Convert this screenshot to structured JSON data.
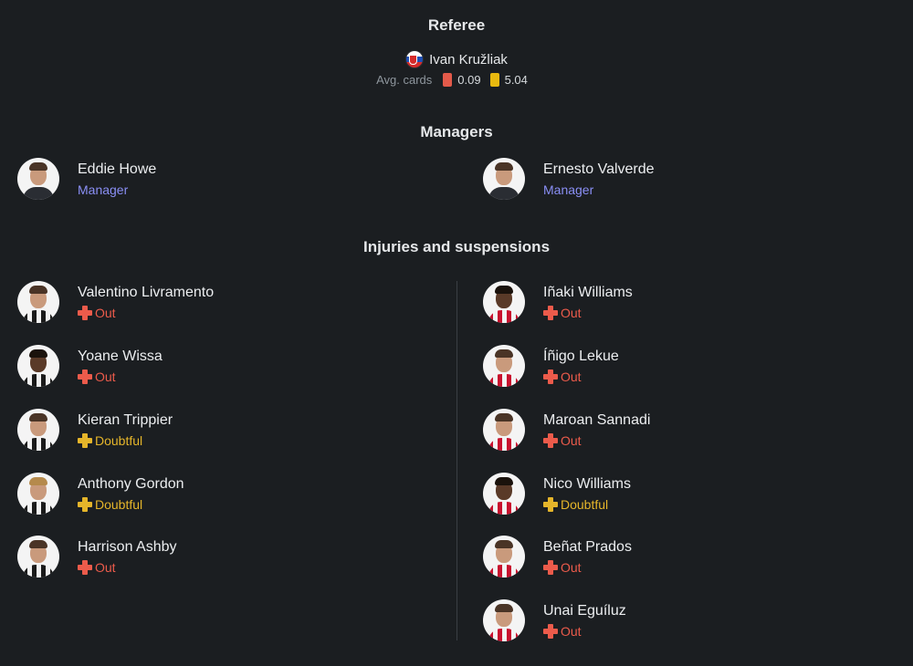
{
  "referee": {
    "title": "Referee",
    "name": "Ivan Kružliak",
    "avg_cards_label": "Avg. cards",
    "red_avg": "0.09",
    "yellow_avg": "5.04"
  },
  "managers": {
    "title": "Managers",
    "home": {
      "name": "Eddie Howe",
      "role": "Manager"
    },
    "away": {
      "name": "Ernesto Valverde",
      "role": "Manager"
    }
  },
  "injuries": {
    "title": "Injuries and suspensions",
    "home": [
      {
        "name": "Valentino Livramento",
        "status": "Out"
      },
      {
        "name": "Yoane Wissa",
        "status": "Out"
      },
      {
        "name": "Kieran Trippier",
        "status": "Doubtful"
      },
      {
        "name": "Anthony Gordon",
        "status": "Doubtful"
      },
      {
        "name": "Harrison Ashby",
        "status": "Out"
      }
    ],
    "away": [
      {
        "name": "Iñaki Williams",
        "status": "Out"
      },
      {
        "name": "Íñigo Lekue",
        "status": "Out"
      },
      {
        "name": "Maroan Sannadi",
        "status": "Out"
      },
      {
        "name": "Nico Williams",
        "status": "Doubtful"
      },
      {
        "name": "Beñat Prados",
        "status": "Out"
      },
      {
        "name": "Unai Eguíluz",
        "status": "Out"
      }
    ]
  },
  "colors": {
    "background": "#1b1e21",
    "out": "#ec5b4b",
    "doubtful": "#e5b52a",
    "manager_role": "#8a8ff5",
    "red_card": "#e35a4a",
    "yellow_card": "#e8b90f"
  }
}
